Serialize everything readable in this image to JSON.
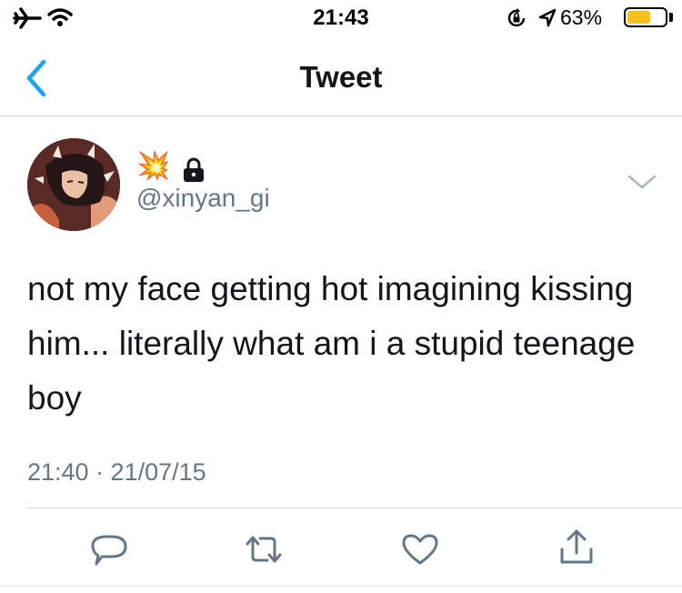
{
  "status_bar": {
    "time": "21:43",
    "battery_percent": "63%",
    "battery_level": 0.63,
    "left_icons": [
      "airplane-icon",
      "wifi-icon"
    ],
    "right_icons": [
      "orientation-lock-icon",
      "location-icon",
      "battery-icon"
    ]
  },
  "nav": {
    "title": "Tweet",
    "back_icon": "chevron-left-icon"
  },
  "tweet": {
    "name_emoji": "💥",
    "lock_icon": "lock-icon",
    "handle": "@xinyan_gi",
    "text": "not my face getting hot imagining kissing him... literally what am i a stupid teenage boy",
    "timestamp": "21:40 · 21/07/15"
  },
  "actions": [
    "reply-icon",
    "retweet-icon",
    "like-icon",
    "share-icon"
  ],
  "colors": {
    "accent": "#1da1f2",
    "secondary_text": "#657786",
    "primary_text": "#14171a",
    "battery_fill": "#f4c21a"
  }
}
